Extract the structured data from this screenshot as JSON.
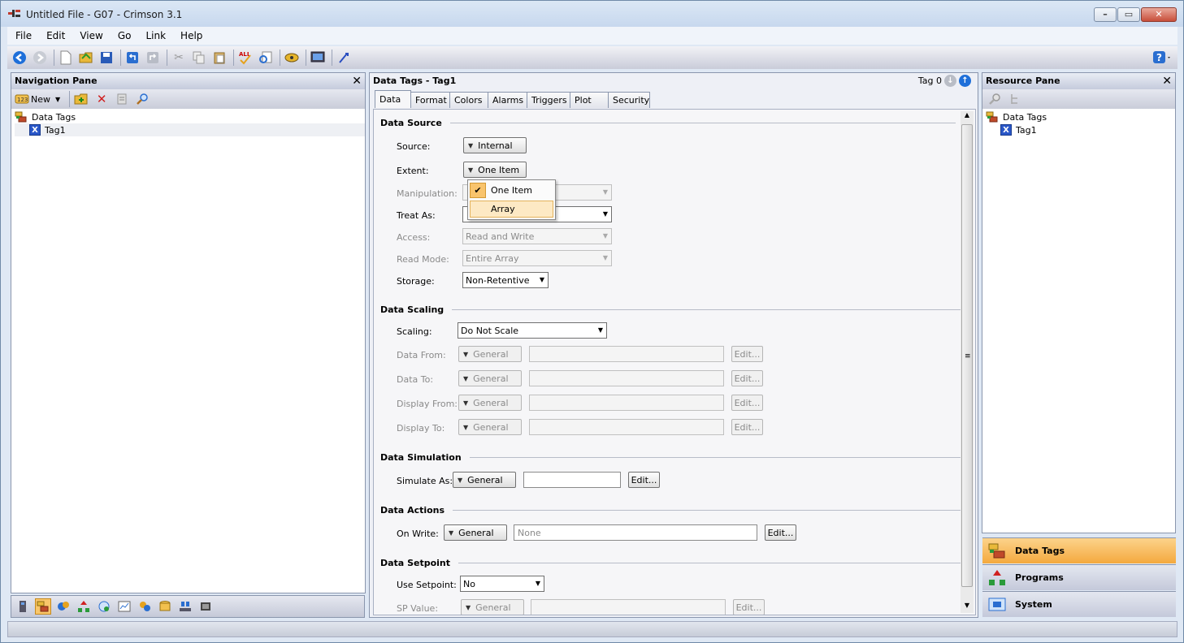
{
  "window": {
    "title": "Untitled File - G07 - Crimson 3.1"
  },
  "menu": [
    "File",
    "Edit",
    "View",
    "Go",
    "Link",
    "Help"
  ],
  "toolbar_icons": [
    "back-icon",
    "forward-icon",
    "new-file-icon",
    "open-folder-icon",
    "save-icon",
    "undo-icon",
    "redo-icon",
    "cut-icon",
    "copy-icon",
    "paste-icon",
    "spell-check-icon",
    "find-icon",
    "link-icon",
    "display-icon",
    "flash-icon"
  ],
  "nav_pane": {
    "title": "Navigation Pane",
    "new_label": "New",
    "tree": [
      {
        "label": "Data Tags",
        "type": "folder"
      },
      {
        "label": "Tag1",
        "type": "tag"
      }
    ]
  },
  "center": {
    "title": "Data Tags - Tag1",
    "tag_nav": "Tag 0",
    "tabs": [
      "Data",
      "Format",
      "Colors",
      "Alarms",
      "Triggers",
      "Plot",
      "Security"
    ],
    "active_tab": "Data",
    "sections": {
      "source": {
        "title": "Data Source",
        "source_label": "Source:",
        "source_value": "Internal",
        "extent_label": "Extent:",
        "extent_value": "One Item",
        "manipulation_label": "Manipulation:",
        "treat_as_label": "Treat As:",
        "access_label": "Access:",
        "access_value": "Read and Write",
        "read_mode_label": "Read Mode:",
        "read_mode_value": "Entire Array",
        "storage_label": "Storage:",
        "storage_value": "Non-Retentive"
      },
      "scaling": {
        "title": "Data Scaling",
        "scaling_label": "Scaling:",
        "scaling_value": "Do Not Scale",
        "rows": [
          {
            "label": "Data From:",
            "mode": "General",
            "edit": "Edit..."
          },
          {
            "label": "Data To:",
            "mode": "General",
            "edit": "Edit..."
          },
          {
            "label": "Display From:",
            "mode": "General",
            "edit": "Edit..."
          },
          {
            "label": "Display To:",
            "mode": "General",
            "edit": "Edit..."
          }
        ]
      },
      "simulation": {
        "title": "Data Simulation",
        "label": "Simulate As:",
        "mode": "General",
        "edit": "Edit..."
      },
      "actions": {
        "title": "Data Actions",
        "label": "On Write:",
        "mode": "General",
        "value_placeholder": "None",
        "edit": "Edit..."
      },
      "setpoint": {
        "title": "Data Setpoint",
        "use_label": "Use Setpoint:",
        "use_value": "No",
        "sp_label": "SP Value:",
        "sp_mode": "General",
        "sp_edit": "Edit..."
      }
    },
    "extent_popup": {
      "items": [
        "One Item",
        "Array"
      ],
      "checked": "One Item",
      "hover": "Array"
    }
  },
  "resource_pane": {
    "title": "Resource Pane",
    "tree": [
      {
        "label": "Data Tags",
        "type": "folder"
      },
      {
        "label": "Tag1",
        "type": "tag"
      }
    ],
    "categories": [
      "Data Tags",
      "Programs",
      "System"
    ],
    "active_category": "Data Tags"
  },
  "colors": {
    "accent_orange": "#f4a93e",
    "tag_blue": "#2a57c8",
    "title_bg": "#c7d8ee"
  }
}
